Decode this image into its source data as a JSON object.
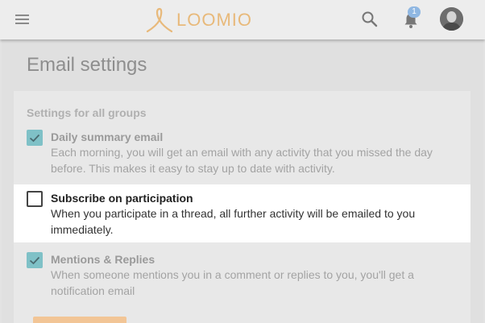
{
  "header": {
    "logo_text": "LOOMIO",
    "notification_count": "1",
    "brand_color": "#e8b97a",
    "badge_color": "#8fb7e2"
  },
  "page": {
    "title": "Email settings"
  },
  "settings": {
    "section_label": "Settings for all groups",
    "options": [
      {
        "title": "Daily summary email",
        "description": "Each morning, you will get an email with any activity that you missed the day before. This makes it easy to stay up to date with activity.",
        "checked": true
      },
      {
        "title": "Subscribe on participation",
        "description": "When you participate in a thread, all further activity will be emailed to you immediately.",
        "checked": false
      },
      {
        "title": "Mentions & Replies",
        "description": "When someone mentions you in a comment or replies to you, you'll get a notification email",
        "checked": true
      }
    ]
  }
}
